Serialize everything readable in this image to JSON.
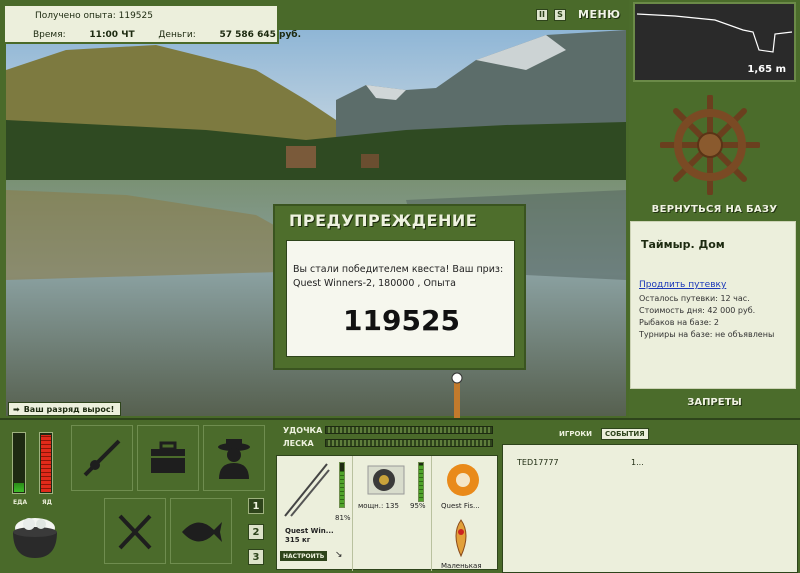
{
  "info": {
    "xp_label": "Получено опыта:",
    "xp_value": "119525",
    "time_label": "Время:",
    "time_value": "11:00 ЧТ",
    "money_label": "Деньги:",
    "money_value": "57 586 645 руб."
  },
  "top": {
    "pause": "II",
    "sound": "S",
    "menu": "МЕНЮ"
  },
  "depth": {
    "value": "1,65 m"
  },
  "base": {
    "back": "ВЕРНУТЬСЯ НА БАЗУ",
    "title": "Таймыр. Дом",
    "extend_link": "Продлить путевку",
    "remaining": "Осталось путевки: 12 час.",
    "day_cost": "Стоимость дня: 42 000 руб.",
    "anglers": "Рыбаков на базе: 2",
    "tournaments": "Турниры на базе: не объявлены",
    "bans": "ЗАПРЕТЫ"
  },
  "dialog": {
    "title": "ПРЕДУПРЕЖДЕНИЕ",
    "message": "Вы стали победителем квеста! Ваш приз: Quest Winners-2, 180000 , Опыта",
    "number": "119525"
  },
  "promo": {
    "text": "Ваш разряд вырос!"
  },
  "gauges": {
    "food_label": "ЕДА",
    "poison_label": "ЯД",
    "food_level": 0.15,
    "poison_level": 0.95
  },
  "meters": {
    "rod": "УДОЧКА",
    "line": "ЛЕСКА"
  },
  "gear": {
    "rod_name": "Quest Win...",
    "rod_weight": "315 кг",
    "rod_pct": "81%",
    "setup": "НАСТРОИТЬ",
    "reel_power": "мощн.: 135",
    "reel_pct": "95%",
    "line_name": "Quest Fis...",
    "lure_name": "Маленькая"
  },
  "pages": [
    "1",
    "2",
    "3"
  ],
  "players": {
    "tab_players": "ИГРОКИ",
    "tab_events": "СОБЫТИЯ",
    "rows": [
      {
        "name": "TED17777",
        "value": "1..."
      }
    ]
  },
  "colors": {
    "frame": "#4a6a2a",
    "panel": "#ecefdc",
    "accent": "#2e441b",
    "link": "#1a37b8"
  }
}
